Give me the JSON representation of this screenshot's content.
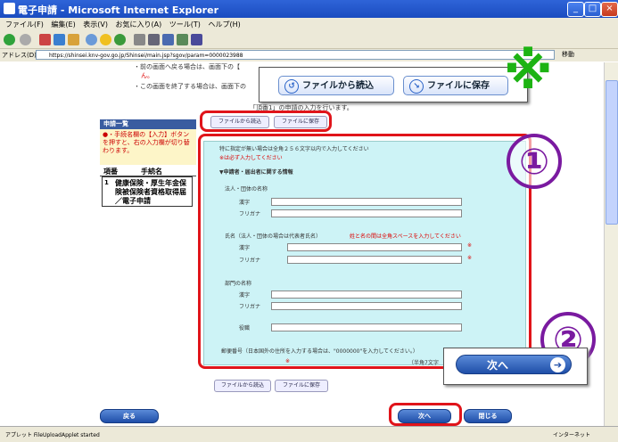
{
  "window": {
    "title": "電子申請 - Microsoft Internet Explorer"
  },
  "menu": [
    "ファイル(F)",
    "編集(E)",
    "表示(V)",
    "お気に入り(A)",
    "ツール(T)",
    "ヘルプ(H)"
  ],
  "address": {
    "label": "アドレス(D)",
    "url": "https://shinsei.knv-gov.go.jp/Shinsei/main.jsp?sgov/param=0000023988",
    "go": "移動"
  },
  "notes": {
    "line1": "・前の画面へ戻る場合は、画面下の【",
    "line1b": "ん。",
    "line2": "・この画面を終了する場合は、画面下の"
  },
  "instruction": "「頂番1」の申請の入力を行います。",
  "left_panel": {
    "heading": "申請一覧",
    "hint": "●・手続名欄の【入力】ボタンを押すと、右の入力欄が切り替わります。",
    "col_num": "項番",
    "col_name": "手続名",
    "item_num": "1",
    "item_name": "健康保険・厚生年金保険被保険者資格取得届／電子申請"
  },
  "file_buttons": {
    "load": "ファイルから読込",
    "save": "ファイルに保存"
  },
  "big_buttons": {
    "load": "ファイルから読込",
    "save": "ファイルに保存"
  },
  "form": {
    "note1": "特に指定が無い場合は全角２５６文字以内で入力してください",
    "note2": "※は必ず入力してください",
    "section": "▼申請者・届出者に関する情報",
    "org_label": "法人・団体の名称",
    "kanji": "漢字",
    "furigana": "フリガナ",
    "name_label": "氏名（法人・団体の場合は代表者氏名）",
    "name_red": "姓と名の間は全角スペースを入力してください",
    "dept_label": "部門の名称",
    "post_label": "役職",
    "zip_label": "郵便番号（日本国外の住所を入力する場合は、\"0000000\"を入力してください。）",
    "zip_hint": "（半角7文字　例）1234567）",
    "req": "※"
  },
  "nav": {
    "back": "戻る",
    "next": "次へ",
    "close": "閉じる"
  },
  "callouts": {
    "asterisk": "※",
    "one": "①",
    "two": "②"
  },
  "next_big": {
    "label": "次へ",
    "arrow": "➔"
  },
  "status": {
    "left": "アプレット FileUploadApplet started",
    "right": "インターネット"
  }
}
